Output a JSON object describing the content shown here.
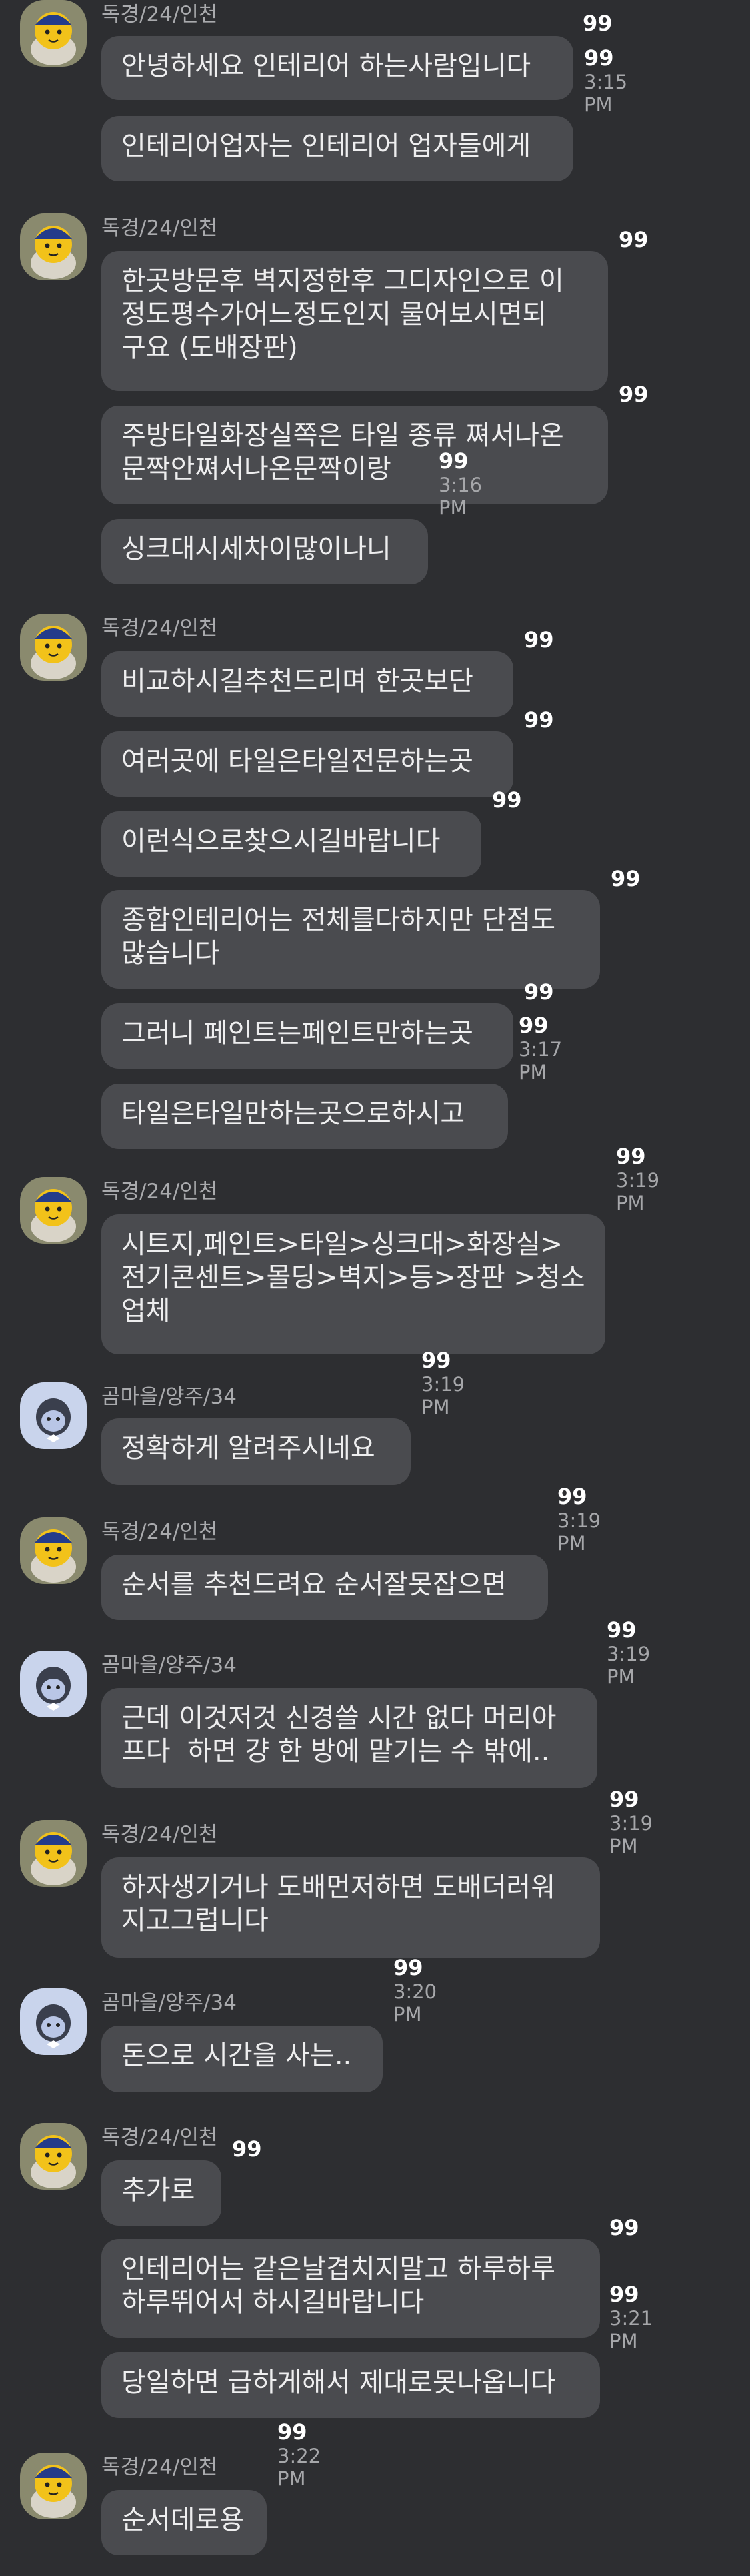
{
  "chat": {
    "groups": [
      {
        "sender": "독경/24/인천",
        "avatar": "yellow-character",
        "messages": [
          {
            "text": "안녕하세요 인테리어 하는사람입니다",
            "count": "99",
            "time": ""
          },
          {
            "text": "인테리어업자는 인테리어 업자들에게",
            "count": "99",
            "time": "3:15 PM"
          }
        ]
      },
      {
        "sender": "독경/24/인천",
        "avatar": "yellow-character",
        "messages": [
          {
            "text": "한곳방문후 벽지정한후 그디자인으로 이\n정도평수가어느정도인지 물어보시면되\n구요 (도배장판)",
            "count": "99",
            "time": ""
          },
          {
            "text": "주방타일화장실쪽은 타일 종류 쪄서나온\n문짝안쪄서나온문짝이랑",
            "count": "99",
            "time": ""
          },
          {
            "text": "싱크대시세차이많이나니",
            "count": "99",
            "time": "3:16 PM"
          }
        ]
      },
      {
        "sender": "독경/24/인천",
        "avatar": "yellow-character",
        "messages": [
          {
            "text": "비교하시길추천드리며 한곳보단",
            "count": "99",
            "time": ""
          },
          {
            "text": "여러곳에 타일은타일전문하는곳",
            "count": "99",
            "time": ""
          },
          {
            "text": "이런식으로찾으시길바랍니다",
            "count": "99",
            "time": ""
          },
          {
            "text": "종합인테리어는 전체를다하지만 단점도\n많습니다",
            "count": "99",
            "time": ""
          },
          {
            "text": "그러니 페인트는페인트만하는곳",
            "count": "99",
            "time": ""
          },
          {
            "text": "타일은타일만하는곳으로하시고",
            "count": "99",
            "time": "3:17 PM"
          }
        ]
      },
      {
        "sender": "독경/24/인천",
        "avatar": "yellow-character",
        "messages": [
          {
            "text": "시트지,페인트>타일>싱크대>화장실>\n전기콘센트>몰딩>벽지>등>장판 >청소\n업체",
            "count": "99",
            "time": "3:19 PM"
          }
        ]
      },
      {
        "sender": "곰마을/양주/34",
        "avatar": "blue-character",
        "messages": [
          {
            "text": "정확하게 알려주시네요",
            "count": "99",
            "time": "3:19 PM"
          }
        ]
      },
      {
        "sender": "독경/24/인천",
        "avatar": "yellow-character",
        "messages": [
          {
            "text": "순서를 추천드려요 순서잘못잡으면",
            "count": "99",
            "time": "3:19 PM"
          }
        ]
      },
      {
        "sender": "곰마을/양주/34",
        "avatar": "blue-character",
        "messages": [
          {
            "text": "근데 이것저것 신경쓸 시간 없다 머리아\n프다  하면 걍 한 방에 맡기는 수 밖에..",
            "count": "99",
            "time": "3:19 PM"
          }
        ]
      },
      {
        "sender": "독경/24/인천",
        "avatar": "yellow-character",
        "messages": [
          {
            "text": "하자생기거나 도배먼저하면 도배더러워\n지고그럽니다",
            "count": "99",
            "time": "3:19 PM"
          }
        ]
      },
      {
        "sender": "곰마을/양주/34",
        "avatar": "blue-character",
        "messages": [
          {
            "text": "돈으로 시간을 사는..",
            "count": "99",
            "time": "3:20 PM"
          }
        ]
      },
      {
        "sender": "독경/24/인천",
        "avatar": "yellow-character",
        "messages": [
          {
            "text": "추가로",
            "count": "99",
            "time": ""
          },
          {
            "text": "인테리어는 같은날겹치지말고 하루하루\n하루뛰어서 하시길바랍니다",
            "count": "99",
            "time": ""
          },
          {
            "text": "당일하면 급하게해서 제대로못나옵니다",
            "count": "99",
            "time": "3:21 PM"
          }
        ]
      },
      {
        "sender": "독경/24/인천",
        "avatar": "yellow-character",
        "messages": [
          {
            "text": "순서데로용",
            "count": "99",
            "time": "3:22 PM"
          }
        ]
      }
    ]
  }
}
